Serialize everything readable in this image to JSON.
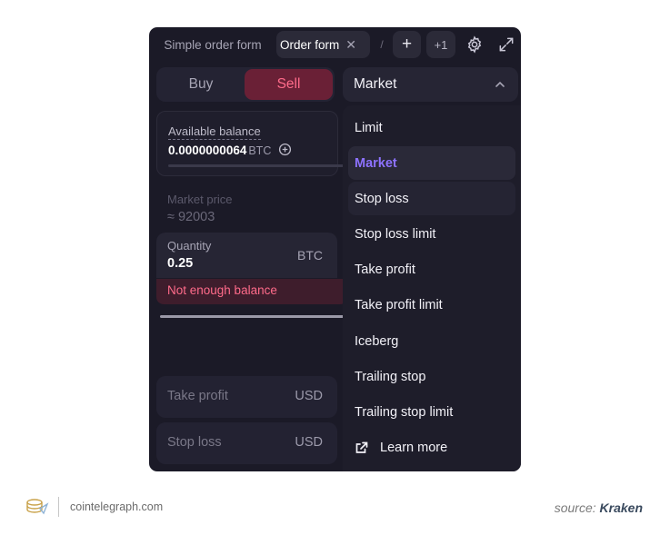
{
  "tabs": {
    "simple_order": "Simple order form",
    "order_form": "Order form",
    "close_glyph": "✕",
    "overflow_glyph": "/",
    "add_glyph": "+",
    "more": "+1"
  },
  "side": {
    "buy": "Buy",
    "sell": "Sell",
    "selected": "Sell"
  },
  "order_type": {
    "selected": "Market"
  },
  "balance": {
    "label": "Available balance",
    "value": "0.0000000064",
    "unit": "BTC"
  },
  "market_price": {
    "label": "Market price",
    "value": "≈  92003"
  },
  "quantity": {
    "label": "Quantity",
    "value": "0.25",
    "unit": "BTC"
  },
  "error": "Not enough balance",
  "take_profit": {
    "label": "Take profit",
    "unit": "USD"
  },
  "stop_loss": {
    "label": "Stop loss",
    "unit": "USD"
  },
  "dropdown": {
    "options": [
      "Limit",
      "Market",
      "Stop loss",
      "Stop loss limit",
      "Take profit",
      "Take profit limit",
      "Iceberg",
      "Trailing stop",
      "Trailing stop limit"
    ],
    "learn_more": "Learn more"
  },
  "footer": {
    "site": "cointelegraph.com",
    "source_prefix": "source:",
    "source_name": "Kraken"
  },
  "colors": {
    "panel_bg": "#1b1a27",
    "sell_accent": "#ff6b8a",
    "active_option": "#8d72ff"
  },
  "icons": [
    "gear-icon",
    "expand-icon",
    "chevron-up-icon",
    "plus-circle-icon",
    "external-link-icon",
    "coin-logo-icon"
  ]
}
